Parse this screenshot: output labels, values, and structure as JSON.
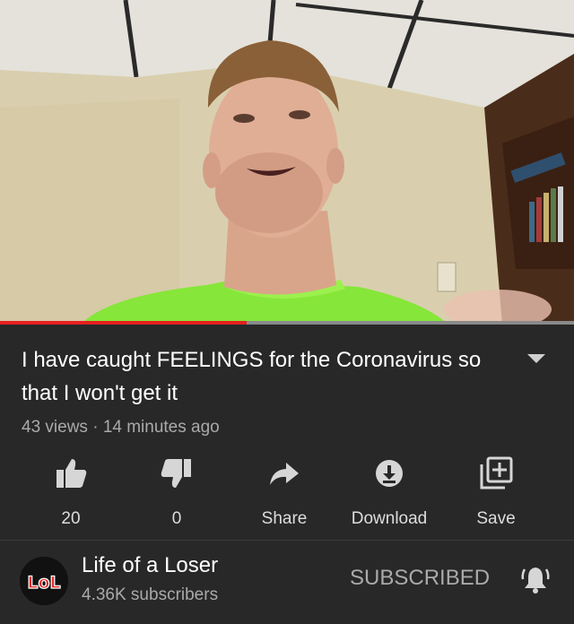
{
  "video": {
    "progress": 0.43
  },
  "info": {
    "title": "I have caught FEELINGS for the Coronavirus so that I won't get it",
    "views": "43 views",
    "separator": "·",
    "uploaded": "14 minutes ago"
  },
  "actions": [
    {
      "icon": "thumbs-up-icon",
      "label": "20"
    },
    {
      "icon": "thumbs-down-icon",
      "label": "0"
    },
    {
      "icon": "share-icon",
      "label": "Share"
    },
    {
      "icon": "download-icon",
      "label": "Download"
    },
    {
      "icon": "add-to-playlist-icon",
      "label": "Save"
    }
  ],
  "channel": {
    "avatar_text": "LoL",
    "name": "Life of a Loser",
    "subscribers": "4.36K subscribers",
    "subscribe_state": "SUBSCRIBED"
  },
  "colors": {
    "background": "#282828",
    "progress": "#e52020",
    "secondary_text": "#aaaaaa"
  }
}
